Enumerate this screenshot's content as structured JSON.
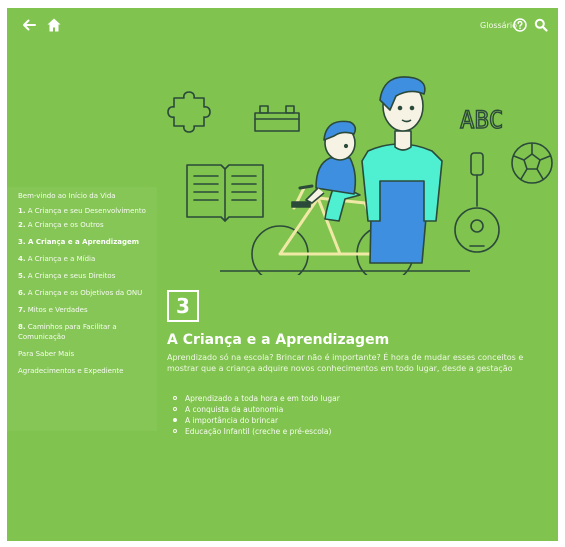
{
  "topbar": {
    "back_icon": "arrow-left-icon",
    "home_icon": "home-icon",
    "glossary_label": "Glossário",
    "help_icon": "question-circle-icon",
    "search_icon": "search-icon"
  },
  "sidebar": {
    "items": [
      {
        "num": "",
        "label": "Bem-vindo ao Início da Vida"
      },
      {
        "num": "1.",
        "label": "A Criança e seu Desenvolvimento"
      },
      {
        "num": "2.",
        "label": "A Criança e os Outros"
      },
      {
        "num": "3.",
        "label": "A Criança e a Aprendizagem"
      },
      {
        "num": "4.",
        "label": "A Criança e a Mídia"
      },
      {
        "num": "5.",
        "label": "A Criança e seus Direitos"
      },
      {
        "num": "6.",
        "label": "A Criança e os Objetivos da ONU"
      },
      {
        "num": "7.",
        "label": "Mitos e Verdades"
      },
      {
        "num": "8.",
        "label": "Caminhos para Facilitar a Comunicação"
      },
      {
        "num": "",
        "label": "Para Saber Mais"
      },
      {
        "num": "",
        "label": "Agradecimentos e Expediente"
      }
    ]
  },
  "illustration": {
    "abc_text": "ABC"
  },
  "chapter": {
    "number": "3",
    "title": "A Criança e a Aprendizagem",
    "description": "Aprendizado só na escola? Brincar não é importante? É hora de mudar esses conceitos e mostrar que a criança adquire novos conhecimentos em todo lugar, desde a gestação",
    "topics": [
      "Aprendizado a toda hora e em todo lugar",
      "A conquista da autonomia",
      "A importância do brincar",
      "Educação Infantil (creche e pré-escola)"
    ]
  },
  "colors": {
    "background": "#80c34f",
    "outline": "#2b4a3a",
    "person_blue": "#3f8fe0",
    "shirt_cyan": "#4ff0d2",
    "skin": "#f6f2e4",
    "text": "#ffffff"
  }
}
